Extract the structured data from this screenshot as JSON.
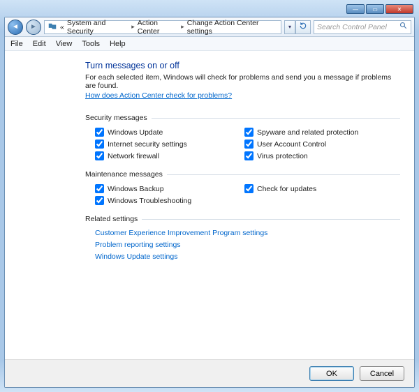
{
  "window_buttons": {
    "min": "—",
    "max": "▭",
    "close": "✕"
  },
  "breadcrumb": {
    "prefix": "«",
    "items": [
      "System and Security",
      "Action Center",
      "Change Action Center settings"
    ]
  },
  "search": {
    "placeholder": "Search Control Panel"
  },
  "menu": [
    "File",
    "Edit",
    "View",
    "Tools",
    "Help"
  ],
  "page": {
    "title": "Turn messages on or off",
    "intro": "For each selected item, Windows will check for problems and send you a message if problems are found.",
    "helplink": "How does Action Center check for problems?"
  },
  "sections": {
    "security": {
      "heading": "Security messages",
      "items": [
        {
          "label": "Windows Update",
          "checked": true
        },
        {
          "label": "Spyware and related protection",
          "checked": true
        },
        {
          "label": "Internet security settings",
          "checked": true
        },
        {
          "label": "User Account Control",
          "checked": true
        },
        {
          "label": "Network firewall",
          "checked": true
        },
        {
          "label": "Virus protection",
          "checked": true
        }
      ]
    },
    "maintenance": {
      "heading": "Maintenance messages",
      "items": [
        {
          "label": "Windows Backup",
          "checked": true
        },
        {
          "label": "Check for updates",
          "checked": true
        },
        {
          "label": "Windows Troubleshooting",
          "checked": true
        }
      ]
    },
    "related": {
      "heading": "Related settings",
      "links": [
        "Customer Experience Improvement Program settings",
        "Problem reporting settings",
        "Windows Update settings"
      ]
    }
  },
  "buttons": {
    "ok": "OK",
    "cancel": "Cancel"
  }
}
